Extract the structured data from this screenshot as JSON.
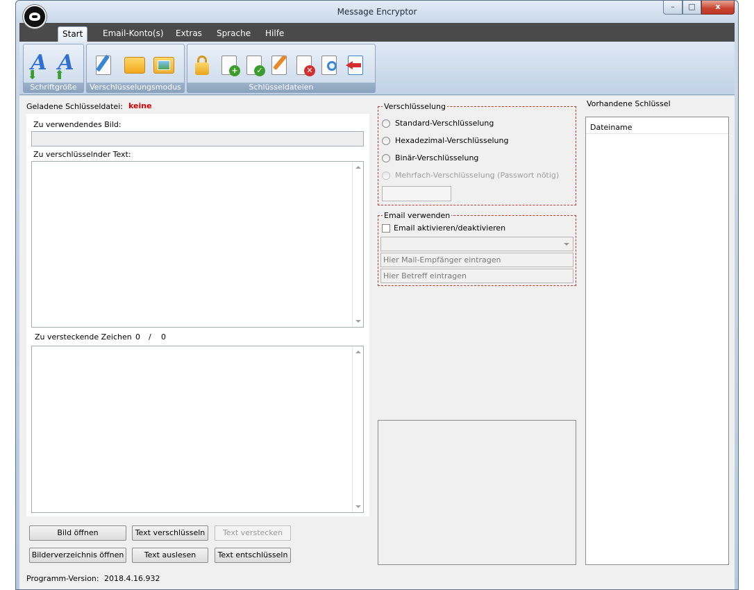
{
  "window": {
    "title": "Message Encryptor",
    "minimize": "–",
    "maximize": "□",
    "close": "x"
  },
  "menu": {
    "tabs": [
      "Start",
      "Email-Konto(s)",
      "Extras",
      "Sprache",
      "Hilfe"
    ]
  },
  "ribbon": {
    "groups": [
      "Schriftgröße",
      "Verschlüsselungsmodus",
      "Schlüsseldateien"
    ]
  },
  "left": {
    "key_file_label": "Geladene Schlüsseldatei:",
    "key_file_value": "keine",
    "image_label": "Zu verwendendes Bild:",
    "image_value": "",
    "text_label": "Zu verschlüsselnder Text:",
    "chars_label": "Zu versteckende Zeichen",
    "chars_count": "0",
    "chars_sep": "/",
    "chars_total": "0"
  },
  "buttons": {
    "open_image": "Bild öffnen",
    "encrypt_text": "Text verschlüsseln",
    "hide_text": "Text verstecken",
    "open_folder": "Bilderverzeichnis öffnen",
    "read_text": "Text auslesen",
    "decrypt_text": "Text entschlüsseln"
  },
  "encryption": {
    "legend": "Verschlüsselung",
    "options": [
      "Standard-Verschlüsselung",
      "Hexadezimal-Verschlüsselung",
      "Binär-Verschlüsselung",
      "Mehrfach-Verschlüsselung (Passwort nötig)"
    ],
    "password_value": ""
  },
  "email": {
    "legend": "Email verwenden",
    "toggle_label": "Email aktivieren/deaktivieren",
    "account_value": "",
    "recipient_placeholder": "Hier Mail-Empfänger eintragen",
    "subject_placeholder": "Hier Betreff eintragen"
  },
  "keys": {
    "title": "Vorhandene Schlüssel",
    "column": "Dateiname",
    "rows": []
  },
  "footer": {
    "version_label": "Programm-Version:",
    "version_value": "2018.4.16.932"
  },
  "colors": {
    "accent_red": "#d40000",
    "dashed_border": "#c0392b",
    "menubar": "#4a4a4a"
  }
}
